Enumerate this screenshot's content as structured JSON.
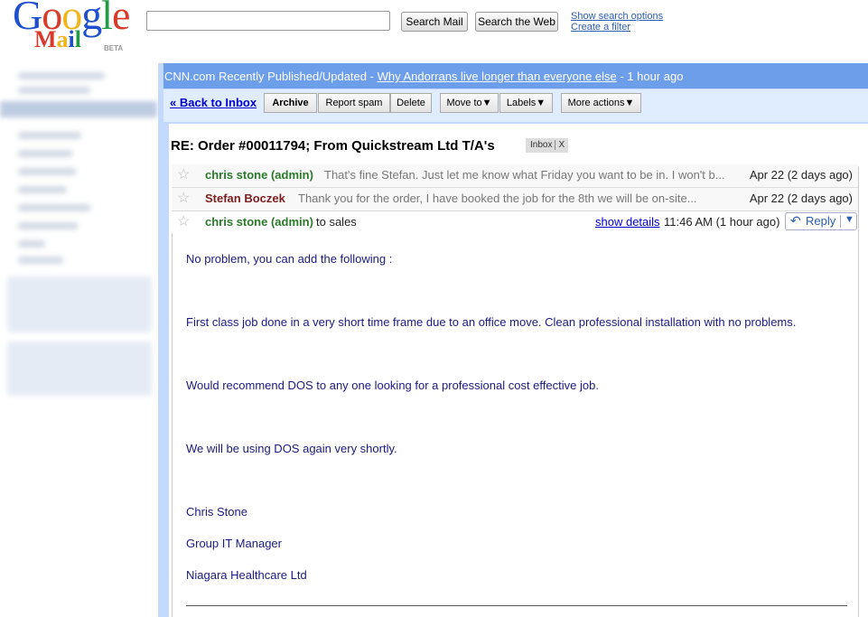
{
  "logo": {
    "google": [
      "G",
      "o",
      "o",
      "g",
      "l",
      "e"
    ],
    "mail": [
      "M",
      "a",
      "i",
      "l"
    ],
    "beta": "BETA",
    "google_colors": [
      "#1f4fcf",
      "#d83a2b",
      "#f1b51c",
      "#1f4fcf",
      "#1f9c44",
      "#d83a2b"
    ],
    "mail_colors": [
      "#d83a2b",
      "#f1b51c",
      "#1f4fcf",
      "#1f9c44"
    ]
  },
  "search": {
    "value": "",
    "search_mail": "Search Mail",
    "search_web": "Search the Web",
    "show_options": "Show search options",
    "create_filter": "Create a filter"
  },
  "webclip": {
    "source": "CNN.com Recently Published/Updated - ",
    "headline": "Why Andorrans live longer than everyone else",
    "age": " - 1 hour ago"
  },
  "toolbar": {
    "back": "« Back to Inbox",
    "archive": "Archive",
    "report_spam": "Report spam",
    "delete": "Delete",
    "move_to": "Move to▼",
    "labels": "Labels▼",
    "more_actions": "More actions▼"
  },
  "thread": {
    "subject": "RE: Order #00011794; From Quickstream Ltd T/A's",
    "label": "Inbox",
    "label_close": "X",
    "messages": [
      {
        "sender": "chris stone (admin)",
        "snippet": "That's fine Stefan. Just let me know what Friday you want to be in. I won't b...",
        "date": "Apr 22 (2 days ago)"
      },
      {
        "sender": "Stefan Boczek",
        "snippet": "Thank you for the order, I have booked the job for the 8th we will be on-site...",
        "date": "Apr 22 (2 days ago)"
      }
    ],
    "open": {
      "sender": "chris stone (admin)",
      "to": "to sales",
      "show_details": "show details",
      "time": "11:46 AM (1 hour ago)",
      "reply": "Reply",
      "body": [
        "No problem, you can add the following :",
        "First class job done in a very short time frame due to an office move. Clean professional installation with no problems.",
        "Would recommend DOS to any one looking for a professional cost effective job.",
        "We will be using DOS again very shortly."
      ],
      "signature": [
        "Chris Stone",
        "Group IT Manager",
        "Niagara Healthcare Ltd"
      ]
    }
  },
  "colors": {
    "admin_sender": "#2a7a2a",
    "other_sender": "#7a1e1e",
    "body_text": "#1a1a80",
    "link": "#0000cc",
    "header_blue": "#6d9eea",
    "toolbar_bg": "#e0ecff"
  }
}
